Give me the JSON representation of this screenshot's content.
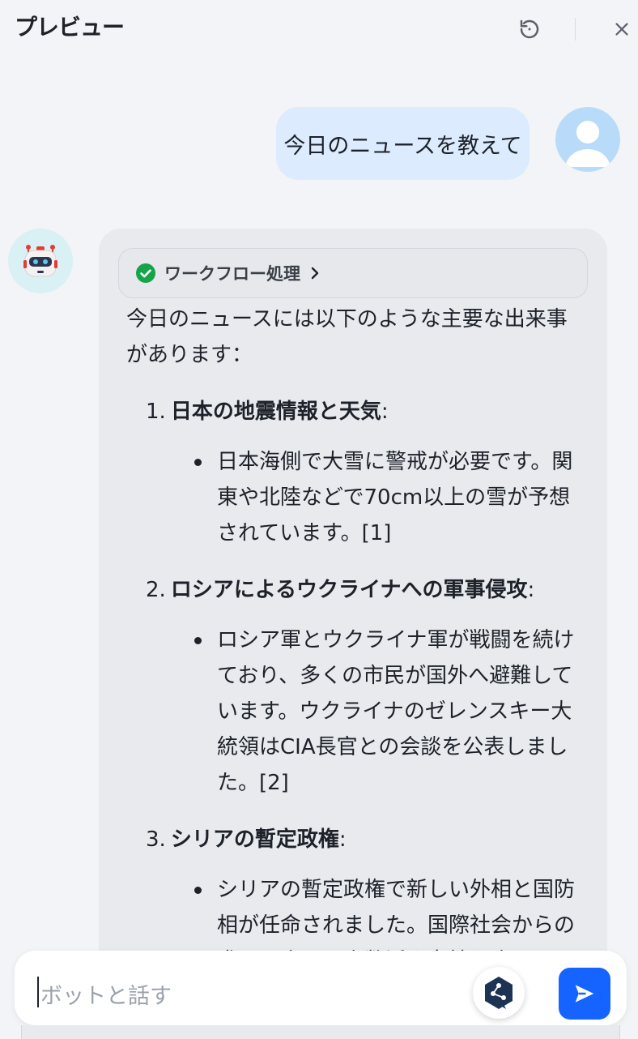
{
  "header": {
    "title": "プレビュー"
  },
  "chat": {
    "user_message": "今日のニュースを教えて",
    "workflow_label": "ワークフロー処理",
    "intro": "今日のニュースには以下のような主要な出来事があります：",
    "items": [
      {
        "number": "1.",
        "title": "日本の地震情報と天気",
        "colon": ":",
        "bullet": "日本海側で大雪に警戒が必要です。関東や北陸などで70cm以上の雪が予想されています。[1]"
      },
      {
        "number": "2.",
        "title": "ロシアによるウクライナへの軍事侵攻",
        "colon": ":",
        "bullet": "ロシア軍とウクライナ軍が戦闘を続けており、多くの市民が国外へ避難しています。ウクライナのゼレンスキー大統領はCIA長官との会談を公表しました。[2]"
      },
      {
        "number": "3.",
        "title": "シリアの暫定政権",
        "colon": ":",
        "bullet": "シリアの暫定政権で新しい外相と国防相が任命されました。国際社会からの求めに応じて少数派や女性を含む国民融和の内閣が発足できるかが焦点となっていま"
      }
    ]
  },
  "input": {
    "placeholder": "ボットと話す",
    "value": ""
  },
  "icons": {
    "reset": "reset-icon",
    "close": "close-icon",
    "agent": "agent-icon",
    "send": "send-icon"
  },
  "colors": {
    "accent": "#1664ff",
    "user_bubble": "#dcebfd",
    "bot_bubble": "#e8eaee",
    "success": "#16a34a"
  }
}
